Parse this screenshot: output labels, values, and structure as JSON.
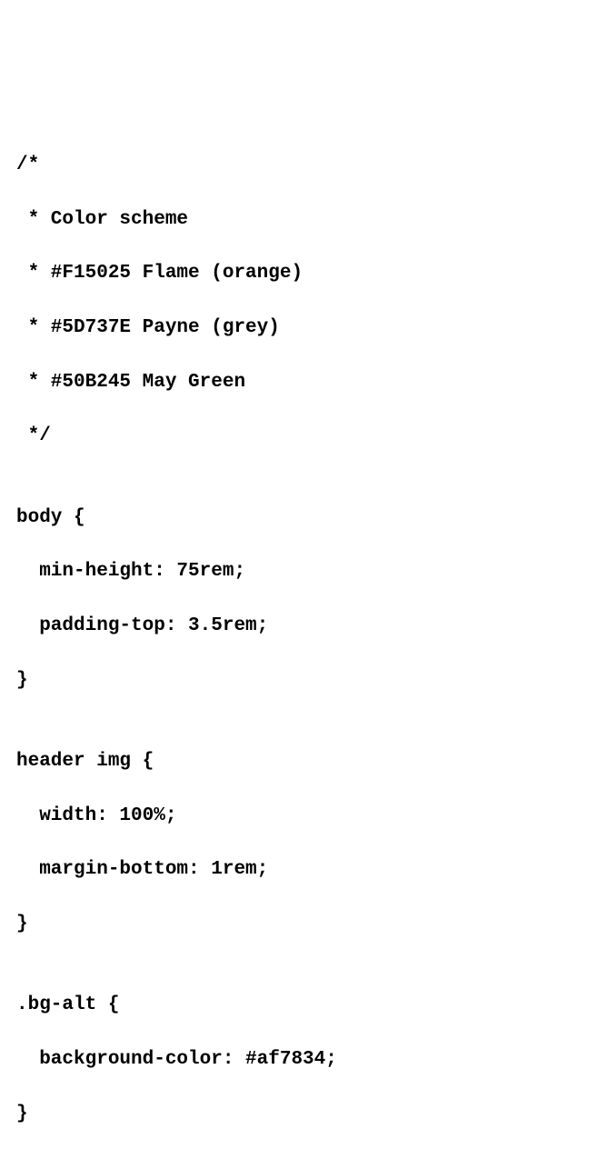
{
  "code": {
    "lines": [
      "/*",
      " * Color scheme",
      " * #F15025 Flame (orange)",
      " * #5D737E Payne (grey)",
      " * #50B245 May Green",
      " */",
      "",
      "body {",
      "  min-height: 75rem;",
      "  padding-top: 3.5rem;",
      "}",
      "",
      "header img {",
      "  width: 100%;",
      "  margin-bottom: 1rem;",
      "}",
      "",
      ".bg-alt {",
      "  background-color: #af7834;",
      "}"
    ]
  }
}
